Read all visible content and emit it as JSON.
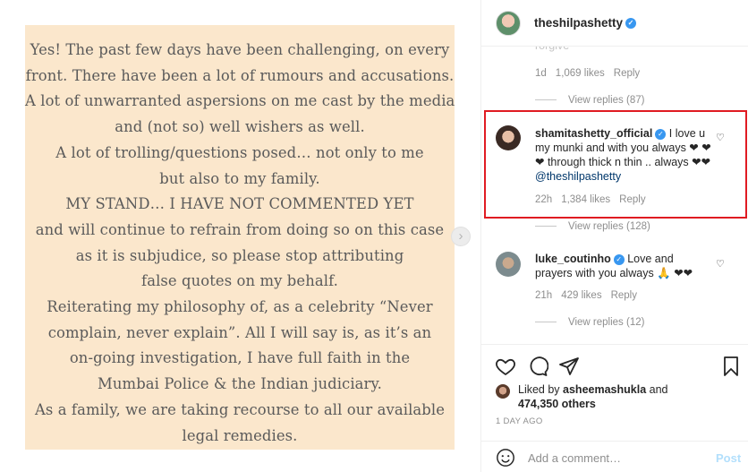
{
  "post_image": {
    "lines": [
      "Yes! The past few days have been challenging, on every",
      "front. There have been a lot of rumours and accusations.",
      "A lot of unwarranted aspersions on me cast by the media",
      "and (not so) well wishers as well.",
      "A lot of trolling/questions posed… not only to me",
      "but also to my family.",
      "MY STAND… I HAVE NOT COMMENTED YET",
      "and will continue to refrain from doing so on this case",
      "as it is subjudice, so please stop attributing",
      "false quotes on my behalf.",
      "Reiterating my philosophy of, as a celebrity “Never",
      "complain, never explain”. All I will say is, as it’s an",
      "on-going investigation, I have full faith in the",
      "Mumbai Police & the Indian judiciary.",
      "As a family, we are taking recourse to all our available",
      "legal remedies."
    ],
    "next_arrow": "›"
  },
  "header": {
    "username": "theshilpashetty",
    "verified_mark": "✓"
  },
  "comments": {
    "partial": {
      "text": "rorgive",
      "age": "1d",
      "likes": "1,069 likes",
      "reply": "Reply",
      "view_replies": "View replies (87)"
    },
    "shamita": {
      "username": "shamitashetty_official",
      "verified_mark": "✓",
      "text": " I love u my munki and with you always ❤ ❤❤ through thick n thin .. always ❤❤ ",
      "mention": "@theshilpashetty",
      "age": "22h",
      "likes": "1,384 likes",
      "reply": "Reply",
      "view_replies": "View replies (128)"
    },
    "luke": {
      "username": "luke_coutinho",
      "verified_mark": "✓",
      "text": " Love and prayers with you always 🙏 ❤❤",
      "age": "21h",
      "likes": "429 likes",
      "reply": "Reply",
      "view_replies": "View replies (12)"
    },
    "heart_glyph": "♡"
  },
  "actions": {
    "liked_by_prefix": "Liked by ",
    "liked_by_user": "asheemashukla",
    "liked_by_and": " and",
    "others_count": "474,350 others",
    "date": "1 DAY AGO",
    "comment_placeholder": "Add a comment…",
    "post_label": "Post"
  },
  "colors": {
    "highlight_border": "#e01b22",
    "verified": "#3897f0",
    "post_bg": "#fbe7cc"
  }
}
